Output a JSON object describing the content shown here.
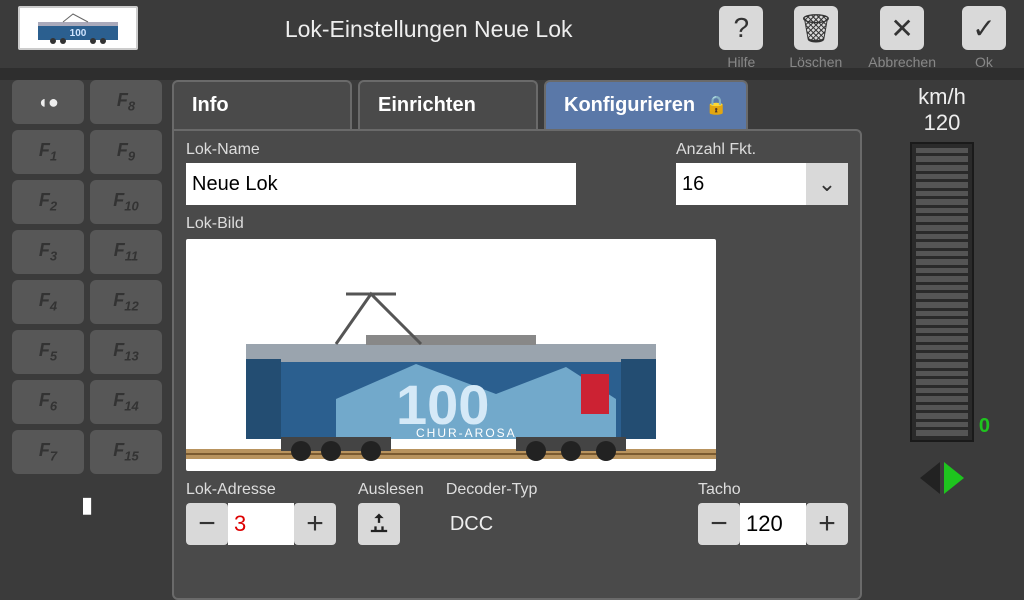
{
  "header": {
    "title": "Lok-Einstellungen Neue Lok",
    "buttons": {
      "help": "Hilfe",
      "delete": "Löschen",
      "cancel": "Abbrechen",
      "ok": "Ok"
    }
  },
  "fkeys": {
    "left": [
      "F1",
      "F2",
      "F3",
      "F4",
      "F5",
      "F6",
      "F7"
    ],
    "right": [
      "F8",
      "F9",
      "F10",
      "F11",
      "F12",
      "F13",
      "F14",
      "F15"
    ],
    "headlight": "●▶"
  },
  "tabs": {
    "info": "Info",
    "setup": "Einrichten",
    "config": "Konfigurieren"
  },
  "form": {
    "nameLabel": "Lok-Name",
    "nameValue": "Neue Lok",
    "fcountLabel": "Anzahl Fkt.",
    "fcountValue": "16",
    "imageLabel": "Lok-Bild",
    "addrLabel": "Lok-Adresse",
    "addrValue": "3",
    "readLabel": "Auslesen",
    "decoderLabel": "Decoder-Typ",
    "decoderValue": "DCC",
    "tachoLabel": "Tacho",
    "tachoValue": "120"
  },
  "speed": {
    "unit": "km/h",
    "max": "120",
    "current": "0"
  },
  "lok_image_text": "100",
  "lok_image_sub": "CHUR-AROSA"
}
